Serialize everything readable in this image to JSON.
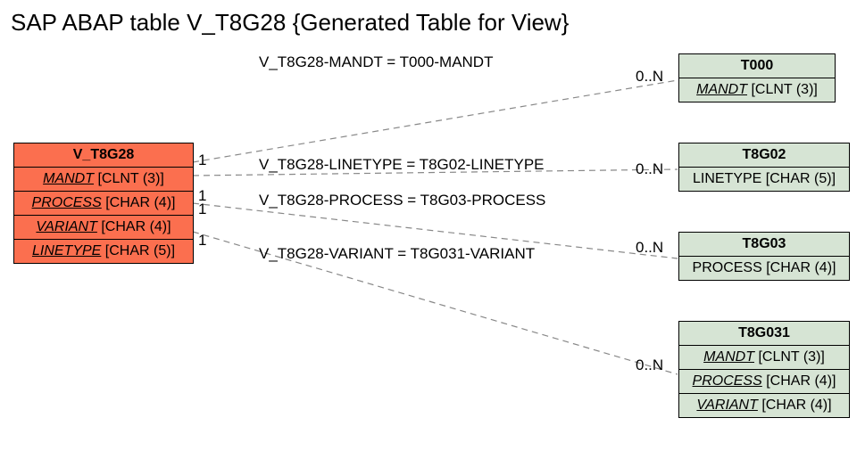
{
  "title": "SAP ABAP table V_T8G28 {Generated Table for View}",
  "main": {
    "name": "V_T8G28",
    "fields": [
      {
        "name": "MANDT",
        "type": "[CLNT (3)]"
      },
      {
        "name": "PROCESS",
        "type": "[CHAR (4)]"
      },
      {
        "name": "VARIANT",
        "type": "[CHAR (4)]"
      },
      {
        "name": "LINETYPE",
        "type": "[CHAR (5)]"
      }
    ]
  },
  "refs": [
    {
      "name": "T000",
      "fields": [
        {
          "name": "MANDT",
          "type": "[CLNT (3)]"
        }
      ]
    },
    {
      "name": "T8G02",
      "fields": [
        {
          "name": "LINETYPE",
          "type": "[CHAR (5)]"
        }
      ]
    },
    {
      "name": "T8G03",
      "fields": [
        {
          "name": "PROCESS",
          "type": "[CHAR (4)]"
        }
      ]
    },
    {
      "name": "T8G031",
      "fields": [
        {
          "name": "MANDT",
          "type": "[CLNT (3)]"
        },
        {
          "name": "PROCESS",
          "type": "[CHAR (4)]"
        },
        {
          "name": "VARIANT",
          "type": "[CHAR (4)]"
        }
      ]
    }
  ],
  "relations": [
    {
      "label": "V_T8G28-MANDT = T000-MANDT",
      "left_card": "1",
      "right_card": "0..N"
    },
    {
      "label": "V_T8G28-LINETYPE = T8G02-LINETYPE",
      "left_card": "1",
      "right_card": "0..N"
    },
    {
      "label": "V_T8G28-PROCESS = T8G03-PROCESS",
      "left_card": "1",
      "right_card": "0..N"
    },
    {
      "label": "V_T8G28-VARIANT = T8G031-VARIANT",
      "left_card": "1",
      "right_card": "0..N"
    }
  ]
}
